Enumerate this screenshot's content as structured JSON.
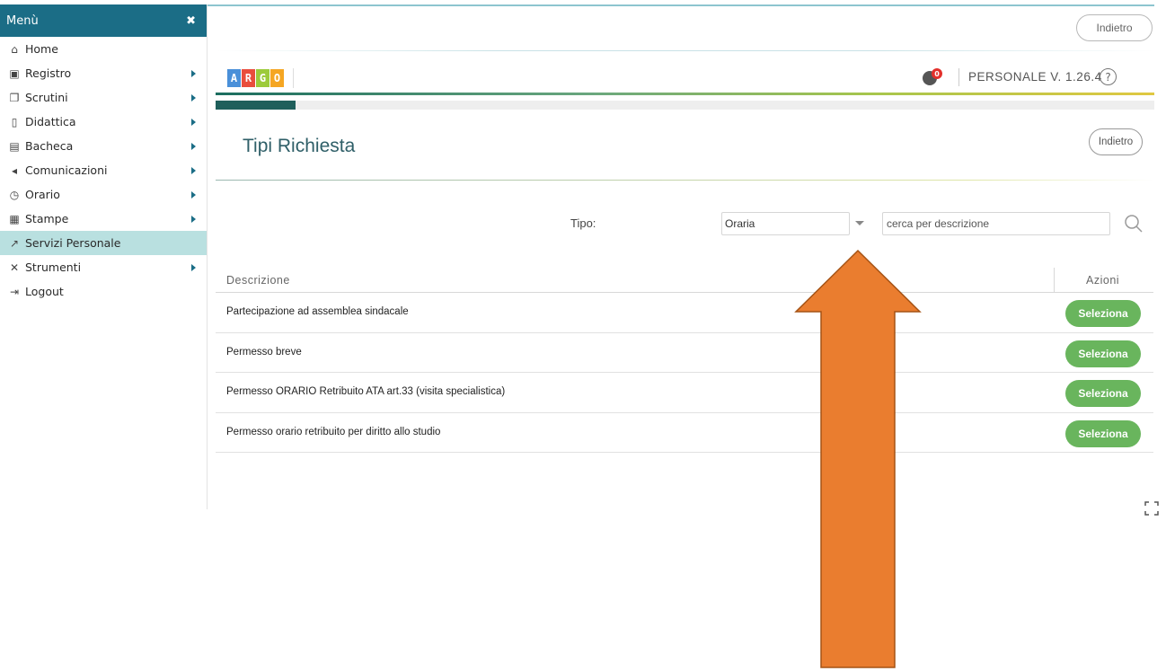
{
  "sidebar": {
    "title": "Menù",
    "items": [
      {
        "label": "Home",
        "icon": "home-icon",
        "caret": false
      },
      {
        "label": "Registro",
        "icon": "calendar-icon",
        "caret": true
      },
      {
        "label": "Scrutini",
        "icon": "document-icon",
        "caret": true
      },
      {
        "label": "Didattica",
        "icon": "book-icon",
        "caret": true
      },
      {
        "label": "Bacheca",
        "icon": "newspaper-icon",
        "caret": true
      },
      {
        "label": "Comunicazioni",
        "icon": "megaphone-icon",
        "caret": true
      },
      {
        "label": "Orario",
        "icon": "clock-icon",
        "caret": true
      },
      {
        "label": "Stampe",
        "icon": "printer-icon",
        "caret": true
      },
      {
        "label": "Servizi Personale",
        "icon": "share-icon",
        "caret": false,
        "active": true
      },
      {
        "label": "Strumenti",
        "icon": "tools-icon",
        "caret": true
      },
      {
        "label": "Logout",
        "icon": "logout-icon",
        "caret": false
      }
    ]
  },
  "topbar": {
    "back_label": "Indietro"
  },
  "header": {
    "logo_letters": [
      "A",
      "R",
      "G",
      "O"
    ],
    "logo_colors": [
      "#4a90d9",
      "#e94e3d",
      "#9ccb3b",
      "#f5a623"
    ],
    "notification_count": "0",
    "version": "PERSONALE V. 1.26.4",
    "help_symbol": "?",
    "progress": 0.085
  },
  "page": {
    "title": "Tipi Richiesta",
    "back_label": "Indietro"
  },
  "filter": {
    "tipo_label": "Tipo:",
    "tipo_value": "Oraria",
    "search_placeholder": "cerca per descrizione"
  },
  "table": {
    "columns": [
      "Descrizione",
      "Azioni"
    ],
    "rows": [
      {
        "descrizione": "Partecipazione ad assemblea sindacale",
        "action": "Seleziona"
      },
      {
        "descrizione": "Permesso breve",
        "action": "Seleziona"
      },
      {
        "descrizione": "Permesso ORARIO Retribuito ATA art.33 (visita specialistica)",
        "action": "Seleziona"
      },
      {
        "descrizione": "Permesso orario retribuito per diritto allo studio",
        "action": "Seleziona"
      }
    ]
  },
  "colors": {
    "menu_header": "#1b6d86",
    "active_item": "#b9e0e0",
    "button_green": "#69b55d",
    "arrow": "#ea7d2f"
  }
}
